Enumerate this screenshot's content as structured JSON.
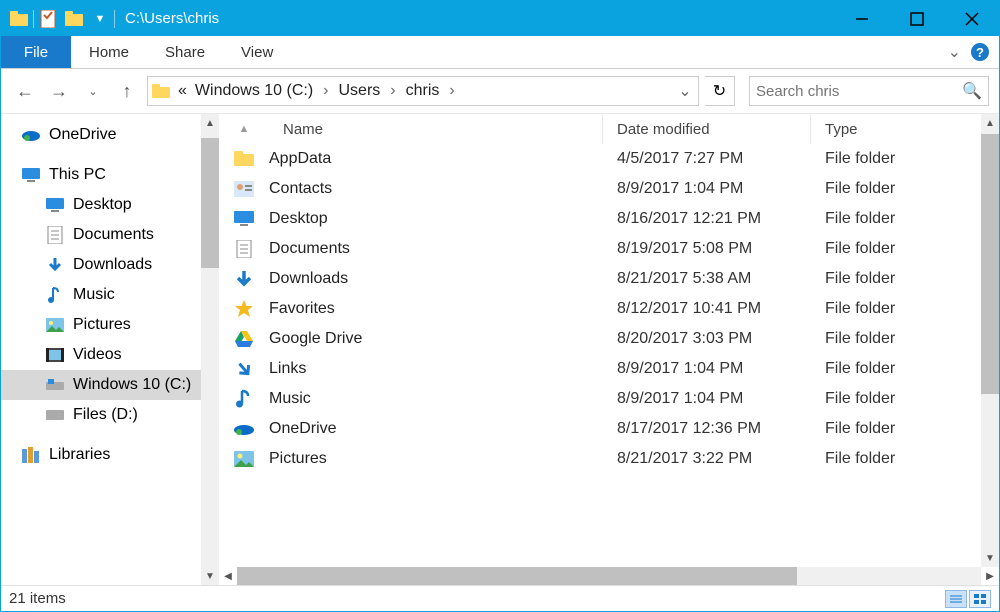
{
  "title_path": "C:\\Users\\chris",
  "tabs": {
    "file": "File",
    "home": "Home",
    "share": "Share",
    "view": "View"
  },
  "breadcrumb": {
    "root": "Windows 10 (C:)",
    "l1": "Users",
    "l2": "chris"
  },
  "search": {
    "placeholder": "Search chris"
  },
  "columns": {
    "name": "Name",
    "date": "Date modified",
    "type": "Type"
  },
  "navpane": {
    "onedrive": "OneDrive",
    "thispc": "This PC",
    "desktop": "Desktop",
    "documents": "Documents",
    "downloads": "Downloads",
    "music": "Music",
    "pictures": "Pictures",
    "videos": "Videos",
    "drive_c": "Windows 10 (C:)",
    "drive_d": "Files (D:)",
    "libraries": "Libraries"
  },
  "files": [
    {
      "name": "AppData",
      "date": "4/5/2017 7:27 PM",
      "type": "File folder",
      "icon": "folder"
    },
    {
      "name": "Contacts",
      "date": "8/9/2017 1:04 PM",
      "type": "File folder",
      "icon": "contacts"
    },
    {
      "name": "Desktop",
      "date": "8/16/2017 12:21 PM",
      "type": "File folder",
      "icon": "desktop"
    },
    {
      "name": "Documents",
      "date": "8/19/2017 5:08 PM",
      "type": "File folder",
      "icon": "documents"
    },
    {
      "name": "Downloads",
      "date": "8/21/2017 5:38 AM",
      "type": "File folder",
      "icon": "downloads"
    },
    {
      "name": "Favorites",
      "date": "8/12/2017 10:41 PM",
      "type": "File folder",
      "icon": "favorites"
    },
    {
      "name": "Google Drive",
      "date": "8/20/2017 3:03 PM",
      "type": "File folder",
      "icon": "gdrive"
    },
    {
      "name": "Links",
      "date": "8/9/2017 1:04 PM",
      "type": "File folder",
      "icon": "links"
    },
    {
      "name": "Music",
      "date": "8/9/2017 1:04 PM",
      "type": "File folder",
      "icon": "music"
    },
    {
      "name": "OneDrive",
      "date": "8/17/2017 12:36 PM",
      "type": "File folder",
      "icon": "onedrive"
    },
    {
      "name": "Pictures",
      "date": "8/21/2017 3:22 PM",
      "type": "File folder",
      "icon": "pictures"
    }
  ],
  "status": {
    "items": "21 items"
  }
}
